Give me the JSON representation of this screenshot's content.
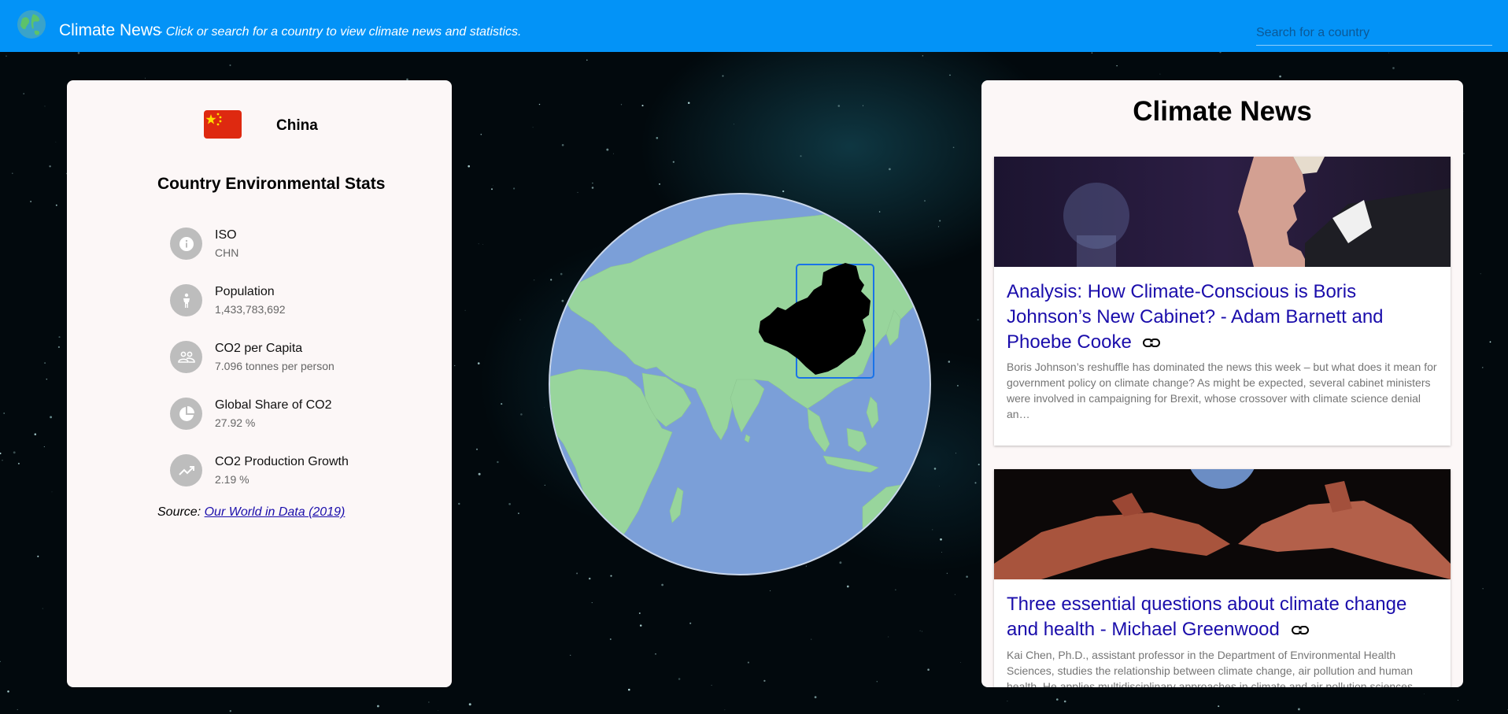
{
  "header": {
    "app_title": "Climate News",
    "subtitle": "- Click or search for a country to view climate news and statistics.",
    "search_placeholder": "Search for a country",
    "background_color": "#0393f7"
  },
  "stats_panel": {
    "country_name": "China",
    "flag": "china-flag",
    "heading": "Country Environmental Stats",
    "stats": [
      {
        "label": "ISO",
        "value": "CHN",
        "icon": "info-icon"
      },
      {
        "label": "Population",
        "value": "1,433,783,692",
        "icon": "person-icon"
      },
      {
        "label": "CO2 per Capita",
        "value": "7.096 tonnes per person",
        "icon": "people-icon"
      },
      {
        "label": "Global Share of CO2",
        "value": "27.92 %",
        "icon": "pie-chart-icon"
      },
      {
        "label": "CO2 Production Growth",
        "value": "2.19 %",
        "icon": "trending-up-icon"
      }
    ],
    "source_prefix": "Source:",
    "source_link": "Our World in Data (2019)"
  },
  "globe": {
    "selected_country": "China",
    "ocean_color": "#7b9fd8",
    "land_color": "#98d59c",
    "selected_color": "#000000"
  },
  "news_panel": {
    "heading": "Climate News",
    "articles": [
      {
        "title": "Analysis: How Climate-Conscious is Boris Johnson’s New Cabinet? - Adam Barnett and Phoebe Cooke",
        "description": "Boris Johnson’s reshuffle has dominated the news this week – but what does it mean for government policy on climate change? As might be expected, several cabinet ministers were involved in campaigning for Brexit, whose crossover with climate science denial an…"
      },
      {
        "title": "Three essential questions about climate change and health - Michael Greenwood",
        "description": "Kai Chen, Ph.D., assistant professor in the Department of Environmental Health Sciences, studies the relationship between climate change, air pollution and human health. He applies multidisciplinary approaches in climate and air pollution sciences"
      }
    ]
  }
}
